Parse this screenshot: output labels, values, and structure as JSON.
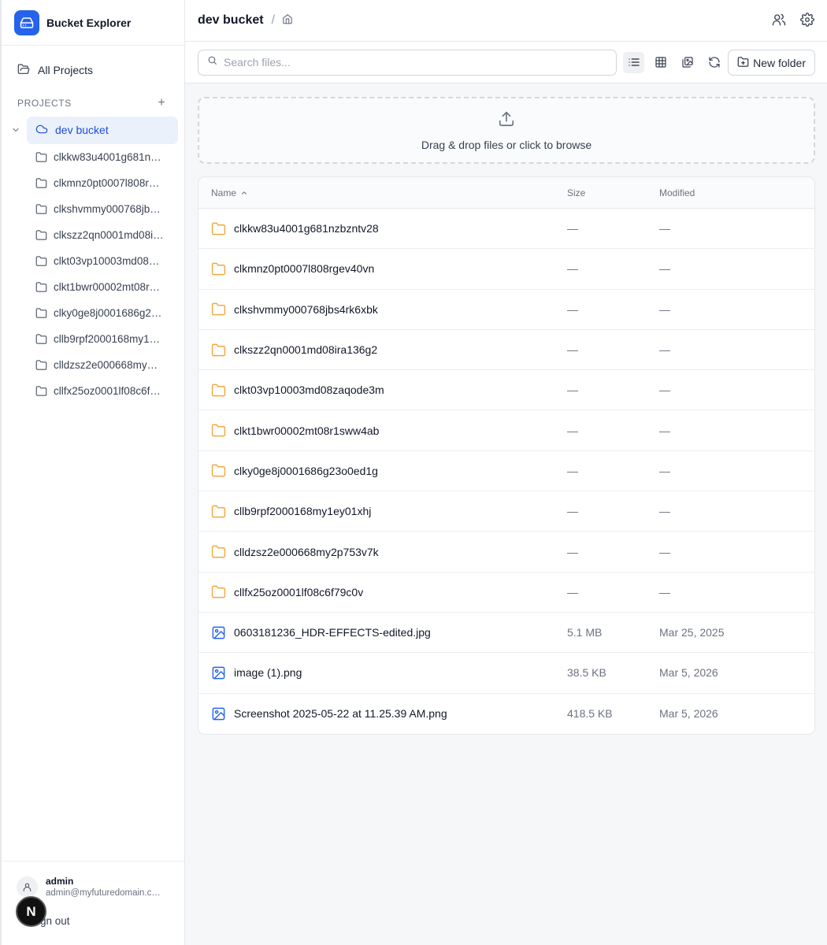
{
  "app": {
    "title": "Bucket Explorer"
  },
  "sidebar": {
    "all_projects": "All Projects",
    "section_label": "PROJECTS",
    "add_label": "+",
    "active_project": "dev bucket",
    "folders": [
      "clkkw83u4001g681n…",
      "clkmnz0pt0007l808r…",
      "clkshvmmy000768jb…",
      "clkszz2qn0001md08i…",
      "clkt03vp10003md08…",
      "clkt1bwr00002mt08r…",
      "clky0ge8j0001686g2…",
      "cllb9rpf2000168my1…",
      "clldzsz2e000668my…",
      "cllfx25oz0001lf08c6f…"
    ]
  },
  "user": {
    "name": "admin",
    "email": "admin@myfuturedomain.c…",
    "signout": "ign out",
    "badge": "N"
  },
  "header": {
    "title": "dev bucket",
    "separator": "/"
  },
  "toolbar": {
    "search_placeholder": "Search files...",
    "new_folder": "New folder"
  },
  "dropzone": {
    "text": "Drag & drop files or click to browse"
  },
  "table": {
    "headers": {
      "name": "Name",
      "size": "Size",
      "modified": "Modified"
    },
    "rows": [
      {
        "type": "folder",
        "name": "clkkw83u4001g681nzbzntv28",
        "size": "—",
        "modified": "—"
      },
      {
        "type": "folder",
        "name": "clkmnz0pt0007l808rgev40vn",
        "size": "—",
        "modified": "—"
      },
      {
        "type": "folder",
        "name": "clkshvmmy000768jbs4rk6xbk",
        "size": "—",
        "modified": "—"
      },
      {
        "type": "folder",
        "name": "clkszz2qn0001md08ira136g2",
        "size": "—",
        "modified": "—"
      },
      {
        "type": "folder",
        "name": "clkt03vp10003md08zaqode3m",
        "size": "—",
        "modified": "—"
      },
      {
        "type": "folder",
        "name": "clkt1bwr00002mt08r1sww4ab",
        "size": "—",
        "modified": "—"
      },
      {
        "type": "folder",
        "name": "clky0ge8j0001686g23o0ed1g",
        "size": "—",
        "modified": "—"
      },
      {
        "type": "folder",
        "name": "cllb9rpf2000168my1ey01xhj",
        "size": "—",
        "modified": "—"
      },
      {
        "type": "folder",
        "name": "clldzsz2e000668my2p753v7k",
        "size": "—",
        "modified": "—"
      },
      {
        "type": "folder",
        "name": "cllfx25oz0001lf08c6f79c0v",
        "size": "—",
        "modified": "—"
      },
      {
        "type": "image",
        "name": "0603181236_HDR-EFFECTS-edited.jpg",
        "size": "5.1 MB",
        "modified": "Mar 25, 2025"
      },
      {
        "type": "image",
        "name": "image (1).png",
        "size": "38.5 KB",
        "modified": "Mar 5, 2026"
      },
      {
        "type": "image",
        "name": "Screenshot 2025-05-22 at 11.25.39 AM.png",
        "size": "418.5 KB",
        "modified": "Mar 5, 2026"
      }
    ]
  },
  "colors": {
    "accent": "#2563eb",
    "folder": "#f0a940",
    "file_icon": "#2563eb",
    "active_bg": "#eaf1fb"
  },
  "icons": {
    "brand": "hard-drive-icon",
    "all_projects": "folder-open-icon",
    "project": "cloud-icon",
    "folder": "folder-icon",
    "image": "image-file-icon",
    "search": "search-icon",
    "list_view": "list-view-icon",
    "grid_view": "grid-view-icon",
    "gallery_view": "gallery-view-icon",
    "refresh": "refresh-icon",
    "new_folder": "folder-plus-icon",
    "upload": "upload-icon",
    "users": "users-icon",
    "settings": "gear-icon",
    "home": "home-icon",
    "sort": "sort-asc-icon"
  }
}
